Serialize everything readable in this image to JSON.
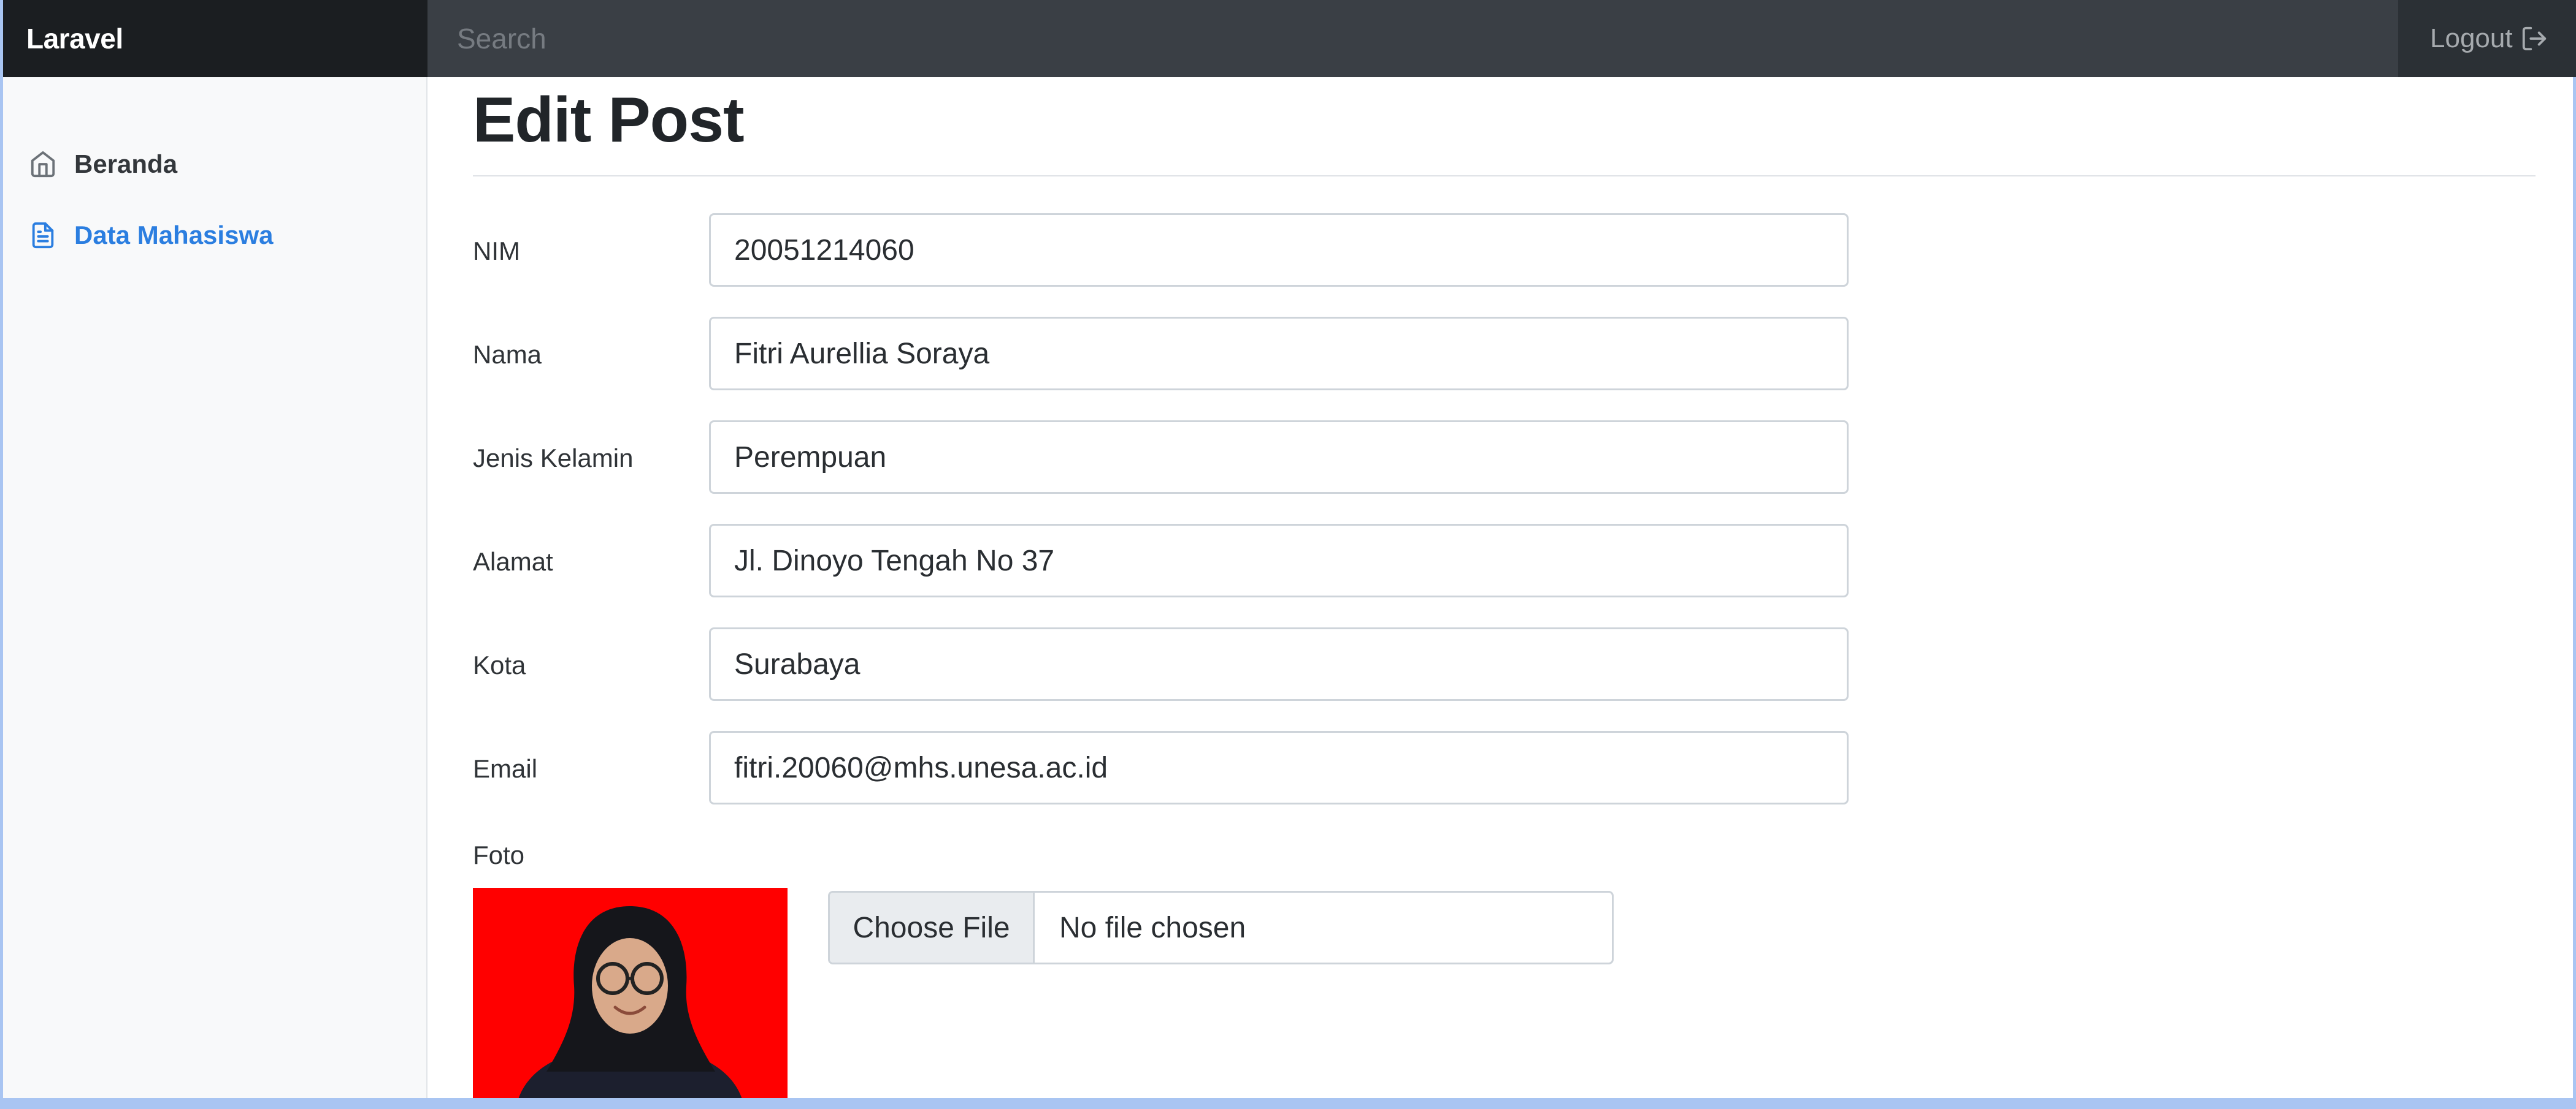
{
  "navbar": {
    "brand": "Laravel",
    "search_placeholder": "Search",
    "logout_label": "Logout"
  },
  "sidebar": {
    "items": [
      {
        "label": "Beranda",
        "icon": "home-icon",
        "active": false
      },
      {
        "label": "Data Mahasiswa",
        "icon": "document-icon",
        "active": true
      }
    ]
  },
  "main": {
    "title": "Edit Post",
    "fields": [
      {
        "label": "NIM",
        "value": "20051214060"
      },
      {
        "label": "Nama",
        "value": "Fitri Aurellia Soraya"
      },
      {
        "label": "Jenis Kelamin",
        "value": "Perempuan"
      },
      {
        "label": "Alamat",
        "value": "Jl. Dinoyo Tengah No 37"
      },
      {
        "label": "Kota",
        "value": "Surabaya"
      },
      {
        "label": "Email",
        "value": "fitri.20060@mhs.unesa.ac.id"
      }
    ],
    "foto": {
      "label": "Foto",
      "choose_file_label": "Choose File",
      "no_file_text": "No file chosen"
    }
  },
  "colors": {
    "navbar": "#343a40",
    "brand_bg": "#1b1e21",
    "sidebar_bg": "#f8f9fa",
    "active_link": "#2b7ee0",
    "photo_bg": "#ff0000"
  }
}
